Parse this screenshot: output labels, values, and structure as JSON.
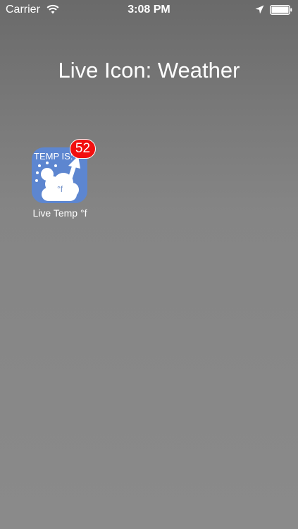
{
  "status_bar": {
    "carrier": "Carrier",
    "time": "3:08 PM",
    "icons": [
      "wifi-icon",
      "location-icon",
      "battery-icon"
    ]
  },
  "page": {
    "title": "Live Icon: Weather"
  },
  "app": {
    "icon_top_text": "TEMP IS:",
    "icon_unit": "°f",
    "badge": "52",
    "label": "Live Temp °f",
    "icon_color": "#5d86d0",
    "badge_color": "#f20f0f"
  }
}
